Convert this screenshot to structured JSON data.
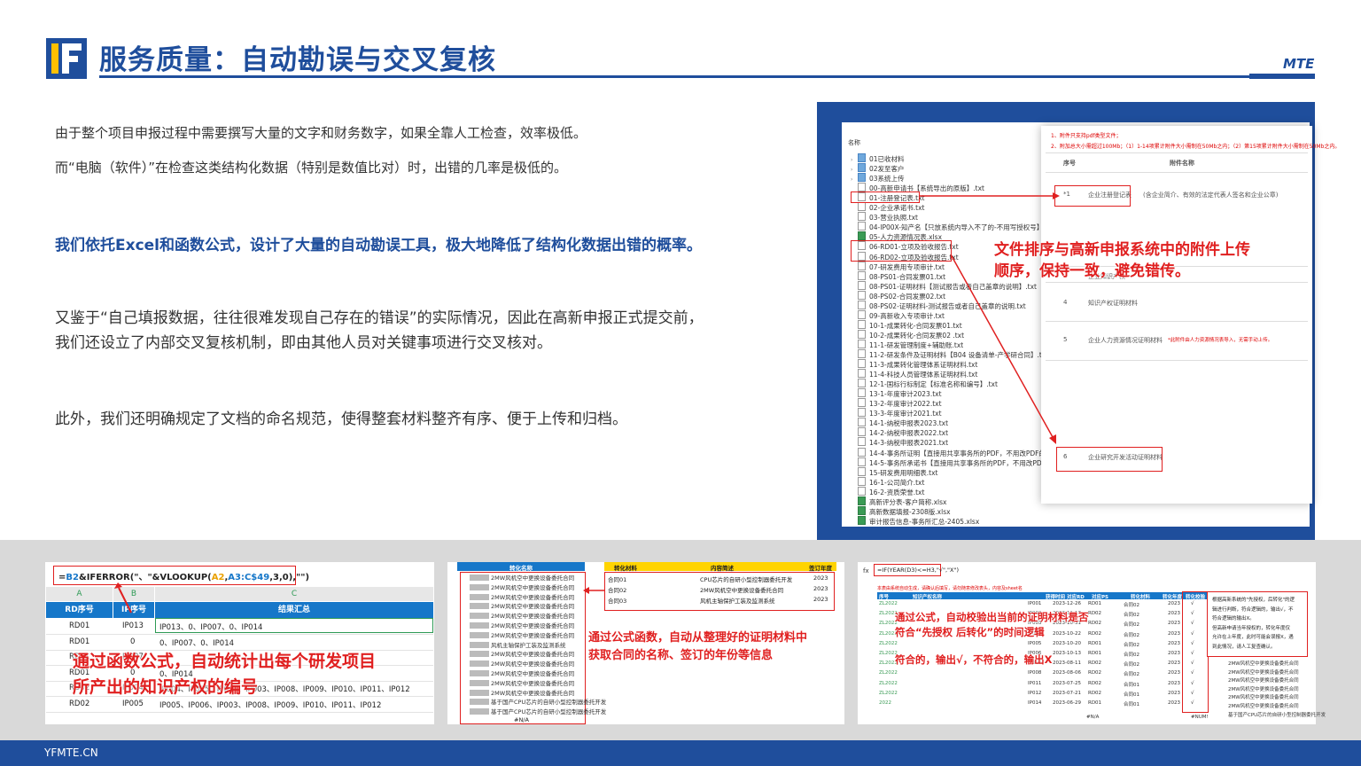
{
  "header": {
    "title": "服务质量：自动勘误与交叉复核",
    "brand": "MTE"
  },
  "body": {
    "p1": "由于整个项目申报过程中需要撰写大量的文字和财务数字，如果全靠人工检查，效率极低。",
    "p2": "而“电脑（软件）”在检查这类结构化数据（特别是数值比对）时，出错的几率是极低的。",
    "p3": "我们依托Excel和函数公式，设计了大量的自动勘误工具，极大地降低了结构化数据出错的概率。",
    "p4a": "又鉴于“自己填报数据，往往很难发现自己存在的错误”的实际情况，因此在高新申报正式提交前，",
    "p4b": "我们还设立了内部交叉复核机制，即由其他人员对关键事项进行交叉核对。",
    "p5": "此外，我们还明确规定了文档的命名规范，使得整套材料整齐有序、便于上传和归档。"
  },
  "right_panel": {
    "col_header": "名称",
    "files": [
      "01已收材料",
      "02发至客户",
      "03系统上传",
      "00-高新申请书【系统导出的原版】.txt",
      "01-注册登记表.txt",
      "02-企业承诺书.txt",
      "03-营业执照.txt",
      "04-IP00X-知产名【只放系统内导入不了的-不用写授权号】.txt",
      "05-人力资源情况表.xlsx",
      "06-RD01-立项及验收报告.txt",
      "06-RD02-立项及验收报告.txt",
      "07-研发费用专项审计.txt",
      "08-PS01-合同发票01.txt",
      "08-PS01-证明材料【测试报告或者自己盖章的说明】.txt",
      "08-PS02-合同发票02.txt",
      "08-PS02-证明材料-测试报告或者自己盖章的说明.txt",
      "09-高新收入专项审计.txt",
      "10-1-成果转化-合同发票01.txt",
      "10-2-成果转化-合同发票02 .txt",
      "11-1-研发管理制度+辅助账.txt",
      "11-2-研发条件及证明材料【B04 设备清单-产学研合同】.txt",
      "11-3-成果转化管理体系证明材料.txt",
      "11-4-科技人员管理体系证明材料.txt",
      "12-1-国标行标制定【标准名称和编号】.txt",
      "13-1-年度审计2023.txt",
      "13-2-年度审计2022.txt",
      "13-3-年度审计2021.txt",
      "14-1-纳税申报表2023.txt",
      "14-2-纳税申报表2022.txt",
      "14-3-纳税申报表2021.txt",
      "14-4-事务所证明【直接用共享事务所的PDF，不用改PDF的名称】.txt",
      "14-5-事务所承诺书【直接用共享事务所的PDF，不用改PDF的名称】.txt",
      "15-研发费用明细表.txt",
      "16-1-公司简介.txt",
      "16-2-资质荣誉.txt",
      "高新评分表-客户简称.xlsx",
      "高新数据填报-2308版.xlsx",
      "审计报告信息-事务所汇总-2405.xlsx"
    ],
    "attach_notes": [
      "1、附件只支持pdf类型文件；",
      "2、附加总大小需超过100Mb；（1）1-14项累计附件大小需制在50Mb之内；（2）第15项累计附件大小需制在50Mb之内。"
    ],
    "attach_header_no": "序号",
    "attach_header_name": "附件名称",
    "attach_rows": [
      {
        "no": "*1",
        "name": "企业注册登记表",
        "desc": "(含企业简介、有效的法定代表人签名和企业公章)"
      },
      {
        "no": "",
        "name": "企业知识产权",
        "desc": ""
      },
      {
        "no": "4",
        "name": "知识产权证明材料",
        "desc": ""
      },
      {
        "no": "5",
        "name": "企业人力资源情况证明材料",
        "desc": "*此附件由人力资源情况表导入，无需手动上传。"
      },
      {
        "no": "6",
        "name": "企业研究开发活动证明材料",
        "desc": ""
      }
    ],
    "overlay": [
      "文件排序与高新申报系统中的附件上传",
      "顺序，保持一致，避免错传。"
    ]
  },
  "card1": {
    "formula_pre": "=",
    "formula_b2": "B2",
    "formula_mid": "&IFERROR(\"、\"&VLOOKUP(",
    "formula_a2": "A2",
    "formula_range": "A3:C$49",
    "formula_tail": ",3,0),\"\")",
    "col_letters": [
      "A",
      "B",
      "C"
    ],
    "headers": [
      "RD序号",
      "IP序号",
      "结果汇总"
    ],
    "rows": [
      [
        "RD01",
        "IP013",
        "IP013、0、IP007、0、IP014"
      ],
      [
        "RD01",
        "0",
        "0、IP007、0、IP014"
      ],
      [
        "RD01",
        "IP007",
        ""
      ],
      [
        "RD01",
        "0",
        "0、IP014"
      ],
      [
        "RD02",
        "IP004",
        "IP004、IP005、IP006、IP003、IP008、IP009、IP010、IP011、IP012"
      ],
      [
        "RD02",
        "IP005",
        "IP005、IP006、IP003、IP008、IP009、IP010、IP011、IP012"
      ]
    ],
    "overlay": [
      "通过函数公式，自动统计出每个研发项目",
      "所产出的知识产权的编号"
    ]
  },
  "card2": {
    "left_header": "转化名称",
    "left_rows": [
      "2MW风机空中更换设备委托合同",
      "2MW风机空中更换设备委托合同",
      "2MW风机空中更换设备委托合同",
      "2MW风机空中更换设备委托合同",
      "2MW风机空中更换设备委托合同",
      "2MW风机空中更换设备委托合同",
      "2MW风机空中更换设备委托合同",
      "风机主轴保护工装及监测系统",
      "2MW风机空中更换设备委托合同",
      "2MW风机空中更换设备委托合同",
      "2MW风机空中更换设备委托合同",
      "2MW风机空中更换设备委托合同",
      "2MW风机空中更换设备委托合同",
      "基于国产CPU芯片的自研小型控制器委托开发",
      "基于国产CPU芯片的自研小型控制器委托开发"
    ],
    "left_bottom": "#N/A",
    "right_headers": [
      "转化材料",
      "内容简述",
      "签订年度"
    ],
    "right_rows": [
      [
        "合同01",
        "CPU芯片的自研小型控制器委托开发",
        "2023"
      ],
      [
        "合同02",
        "2MW风机空中更换设备委托合同",
        "2023"
      ],
      [
        "合同03",
        "风机主轴保护工装及监测系统",
        "2023"
      ]
    ],
    "overlay": [
      "通过公式函数，自动从整理好的证明材料中",
      "获取合同的名称、签订的年份等信息"
    ]
  },
  "card3": {
    "fx": "fx",
    "formula": "=IF(YEAR(D3)<=H3,\"√\",\"X\")",
    "note_top": "本表由系统自动生成，请确认后填写，请勿随意修改表头，内容及sheet名",
    "headers": [
      "序号",
      "知识产权名称",
      "获得时间",
      "对应RD",
      "对应PS",
      "转化材料",
      "转化年度",
      "转化校验"
    ],
    "rows": [
      [
        "ZL2022",
        "IP001",
        "2023-12-26",
        "RD01",
        "合同02",
        "2023"
      ],
      [
        "ZL2022",
        "IP002",
        "2023-11-17",
        "RD02",
        "合同02",
        "2023"
      ],
      [
        "ZL2022",
        "IP003",
        "2023-10-31",
        "RD02",
        "合同02",
        "2023"
      ],
      [
        "ZL2022",
        "IP004",
        "2023-10-22",
        "RD02",
        "合同02",
        "2023"
      ],
      [
        "ZL2022",
        "IP005",
        "2023-10-20",
        "RD01",
        "合同02",
        "2023"
      ],
      [
        "ZL2022",
        "IP006",
        "2023-10-13",
        "RD01",
        "合同02",
        "2023"
      ],
      [
        "ZL2022",
        "IP007",
        "2023-08-11",
        "RD02",
        "合同02",
        "2023"
      ],
      [
        "ZL2022",
        "IP008",
        "2023-08-06",
        "RD02",
        "合同02",
        "2023"
      ],
      [
        "ZL2022",
        "IP011",
        "2023-07-25",
        "RD02",
        "合同01",
        "2023"
      ],
      [
        "ZL2022",
        "IP012",
        "2023-07-21",
        "RD02",
        "合同01",
        "2023"
      ],
      [
        "2022",
        "IP014",
        "2023-06-29",
        "RD01",
        "合同01",
        "2023"
      ]
    ],
    "mark": "√",
    "bottom": [
      "#N/A",
      "#NUM!"
    ],
    "side_note": [
      "根据高新系统的\"先授权，后转化\"的逻",
      "辑进行判断，符合逻辑的，输出√，不",
      "符合逻辑的输出X。",
      "但高新申请当年授权的，转化年度仅",
      "允许在上年度，此时可能会误报X，遇",
      "到此情况，请人工复查确认。"
    ],
    "side_rows": [
      "2MW风机空中更换设备委托合同",
      "2MW风机空中更换设备委托合同",
      "2MW风机空中更换设备委托合同",
      "2MW风机空中更换设备委托合同",
      "2MW风机空中更换设备委托合同",
      "2MW风机空中更换设备委托合同",
      "基于国产CPU芯片的自研小型控制器委托开发"
    ],
    "overlay": [
      "通过公式，自动校验出当前的证明材料是否",
      "符合“先授权 后转化”的时间逻辑",
      "符合的，输出√，不符合的，输出X"
    ]
  },
  "footer": {
    "site": "YFMTE.CN"
  }
}
